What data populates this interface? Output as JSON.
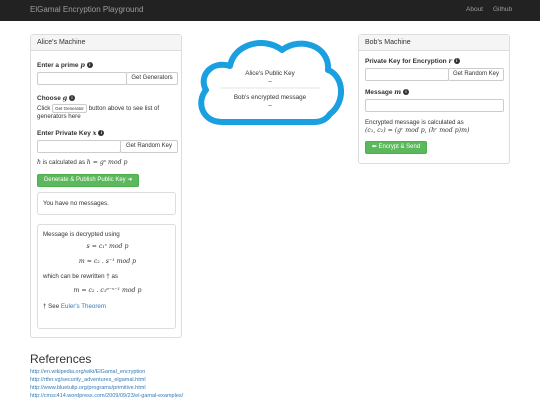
{
  "navbar": {
    "brand": "ElGamal Encryption Playground",
    "links": [
      "About",
      "Github"
    ]
  },
  "alice": {
    "title": "Alice's Machine",
    "prime_label": "Enter a prime",
    "prime_var": "p",
    "get_generators": "Get Generators",
    "choose_label": "Choose",
    "choose_var": "g",
    "click_text": "Click",
    "generator_btn": "Get Generator",
    "button_above_text": "button above to see list of generators here",
    "private_label": "Enter Private Key",
    "private_var": "x",
    "get_random_key": "Get Random Key",
    "h_calc_text": "is calculated as",
    "h_var": "h",
    "h_formula": "h = gˣ mod p",
    "publish_btn": "Generate & Publish Public Key ➜",
    "no_messages": "You have no messages.",
    "decrypt_text": "Message is decrypted using",
    "eq1": "s = c₁ˣ mod p",
    "eq2": "m = c₂ . s⁻¹ mod p",
    "rewritten_text": "which can be rewritten † as",
    "eq3": "m = c₂ . c₁ᵖ⁻ˣ⁻¹ mod p",
    "see_text": "† See",
    "euler_link": "Euler's Theorem"
  },
  "cloud": {
    "alice_key_label": "Alice's Public Key",
    "alice_key_value": "–",
    "bob_msg_label": "Bob's encrypted message",
    "bob_msg_value": "–"
  },
  "bob": {
    "title": "Bob's Machine",
    "private_label": "Private Key for Encryption",
    "private_var": "r",
    "get_random_key": "Get Random Key",
    "message_label": "Message",
    "message_var": "m",
    "encrypted_text": "Encrypted message is calculated as",
    "encrypted_formula": "(c₁, c₂) = (gʳ mod p, (hʳ mod p)m)",
    "encrypt_btn": "⬅ Encrypt & Send"
  },
  "references": {
    "title": "References",
    "links": [
      "http://en.wikipedia.org/wiki/ElGamal_encryption",
      "http://rtfer.vg/security_adventures_elgamal.html",
      "http://www.bluetulip.org/programs/primitive.html",
      "http://cmsc414.wordpress.com/2009/09/23/el-gamal-examples/"
    ]
  },
  "colors": {
    "navbar": "#222222",
    "success": "#5cb85c",
    "cloud": "#1a9fe0",
    "link": "#337ab7"
  }
}
